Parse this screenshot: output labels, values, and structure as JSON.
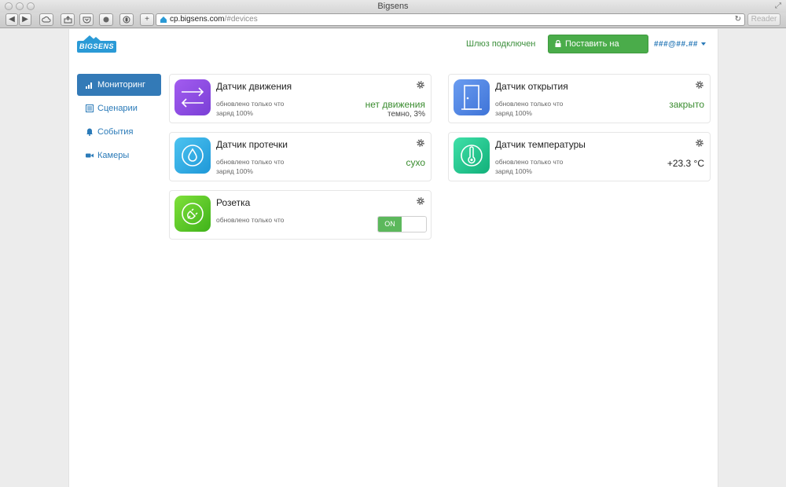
{
  "window": {
    "title": "Bigsens",
    "address_domain": "cp.bigsens.com",
    "address_path": "/#devices",
    "reader_label": "Reader",
    "back_label": "◀",
    "forward_label": "▶",
    "add_label": "+"
  },
  "header": {
    "logo_text": "BIGSENS",
    "gateway_status": "Шлюз подключен",
    "arm_button": "Поставить на охрану",
    "user": "###@##.##"
  },
  "sidebar": {
    "items": [
      {
        "label": "Мониторинг",
        "icon": "bar-chart-icon",
        "active": true
      },
      {
        "label": "Сценарии",
        "icon": "list-icon",
        "active": false
      },
      {
        "label": "События",
        "icon": "bell-icon",
        "active": false
      },
      {
        "label": "Камеры",
        "icon": "video-camera-icon",
        "active": false
      }
    ]
  },
  "devices": {
    "motion": {
      "title": "Датчик движения",
      "updated": "обновлено только что",
      "battery": "заряд 100%",
      "state": "нет движения",
      "state2": "темно, 3%",
      "icon": "motion-arrows-icon",
      "color": "#8e4fe0"
    },
    "door": {
      "title": "Датчик открытия",
      "updated": "обновлено только что",
      "battery": "заряд 100%",
      "state": "закрыто",
      "icon": "door-icon",
      "color": "#4d86e4"
    },
    "leak": {
      "title": "Датчик протечки",
      "updated": "обновлено только что",
      "battery": "заряд 100%",
      "state": "сухо",
      "icon": "water-drop-icon",
      "color": "#28a8e0"
    },
    "temperature": {
      "title": "Датчик температуры",
      "updated": "обновлено только что",
      "battery": "заряд 100%",
      "state": "+23.3 °C",
      "icon": "thermometer-icon",
      "color": "#20c48a"
    },
    "socket": {
      "title": "Розетка",
      "updated": "обновлено только что",
      "toggle_label": "ON",
      "icon": "plug-icon",
      "color": "#5fcf2c"
    }
  },
  "colors": {
    "accent": "#337ab7",
    "success": "#4aac4a",
    "ok_text": "#3a8c2f"
  }
}
